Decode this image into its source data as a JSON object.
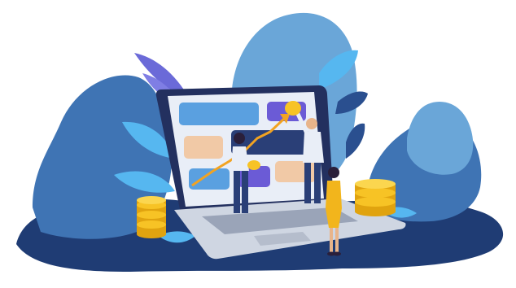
{
  "illustration": {
    "subject": "laptop-dashboard-with-coins",
    "palette": {
      "blob_light": "#6aa6d8",
      "blob_mid": "#3f74b4",
      "blob_dark": "#1f3c74",
      "screen_frame": "#23305f",
      "screen_bg": "#e9eef7",
      "card_blue": "#5aa0e0",
      "card_peach": "#f1c9a6",
      "card_purple": "#6b5bd6",
      "card_navy": "#2a3f77",
      "trend_line": "#f2a321",
      "coin": "#f7c325",
      "coin_shadow": "#e0a30f",
      "leaf_purple": "#6b6ad8",
      "leaf_sky": "#56b7f0",
      "laptop_base": "#cfd6e2",
      "keyboard": "#9aa4b8"
    },
    "icons": [
      "coin-stack-icon",
      "leaf-icon",
      "trend-arrow-icon",
      "person-icon"
    ]
  }
}
